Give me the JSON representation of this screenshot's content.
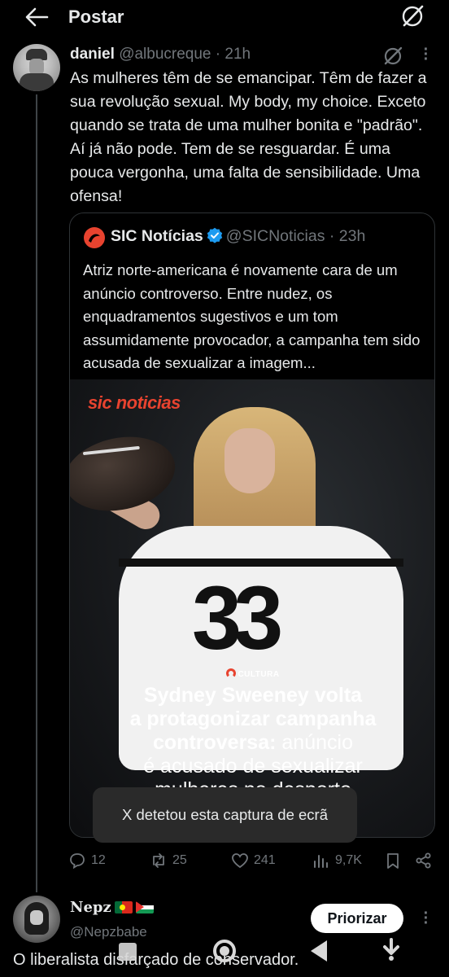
{
  "header": {
    "title": "Postar",
    "back_icon": "arrow-left-icon",
    "grok_icon": "grok-icon"
  },
  "tweet": {
    "author_name": "daniel",
    "author_handle": "@albucreque",
    "time": "· 21h",
    "text": "As mulheres têm de se emancipar. Têm de fazer a sua revolução sexual. My body, my choice. Exceto quando se trata de uma mulher bonita e \"padrão\". Aí já não pode. Tem de se resguardar. É uma pouca vergonha, uma falta de sensibilidade. Uma ofensa!"
  },
  "quote": {
    "author_name": "SIC Notícias",
    "author_handle": "@SICNoticias",
    "time": "· 23h",
    "verified": true,
    "text": "Atriz norte-americana é novamente cara de um anúncio controverso. Entre nudez, os enquadramentos sugestivos e um tom assumidamente provocador, a campanha tem sido acusada de sexualizar a imagem...",
    "image": {
      "brand": "sic noticias",
      "section": "CULTURA",
      "jersey_text": "33",
      "headline_bold_1": "Sydney Sweeney volta",
      "headline_bold_2": "a protagonizar campanha",
      "headline_bold_3": "controversa:",
      "headline_rest_3": " anúncio",
      "headline_line_4": "é acusado de sexualizar",
      "headline_line_5": "mulheres no desporto"
    }
  },
  "toast": {
    "text": "X detetou esta captura de ecrã"
  },
  "actions": {
    "replies": "12",
    "reposts": "25",
    "likes": "241",
    "views": "9,7K"
  },
  "reply": {
    "author_name": "Nepz",
    "author_handle": "@Nepzbabe",
    "prioritize_label": "Priorizar",
    "text": "O liberalista disfarçado de conservador."
  },
  "colors": {
    "background": "#000000",
    "text": "#e7e9ea",
    "muted": "#71767b",
    "verified": "#1d9bf0",
    "sic_red": "#e8432f"
  }
}
